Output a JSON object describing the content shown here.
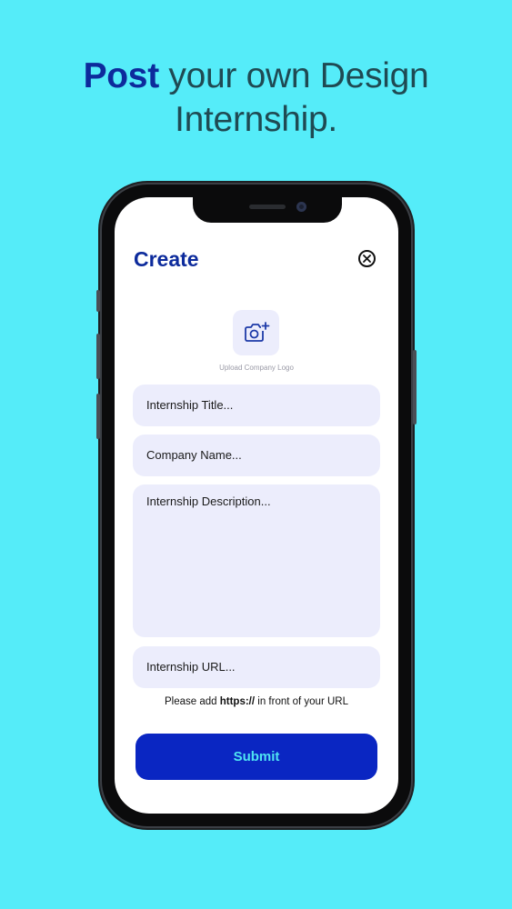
{
  "headline": {
    "accent": "Post",
    "rest_line1": " your own Design",
    "line2": "Internship."
  },
  "screen": {
    "title": "Create",
    "close_icon": "close-circle-icon",
    "upload_icon": "camera-plus-icon",
    "upload_caption": "Upload Company Logo",
    "fields": {
      "title_placeholder": "Internship Title...",
      "company_placeholder": "Company Name...",
      "description_placeholder": "Internship Description...",
      "url_placeholder": "Internship URL..."
    },
    "hint": {
      "before": "Please add ",
      "bold": "https://",
      "after": " in front of your URL"
    },
    "submit_label": "Submit"
  },
  "colors": {
    "background": "#55ecf9",
    "accent": "#0d2b9c",
    "button": "#0a26c2",
    "button_text": "#4fe4f2",
    "field_bg": "#ecedfc"
  }
}
